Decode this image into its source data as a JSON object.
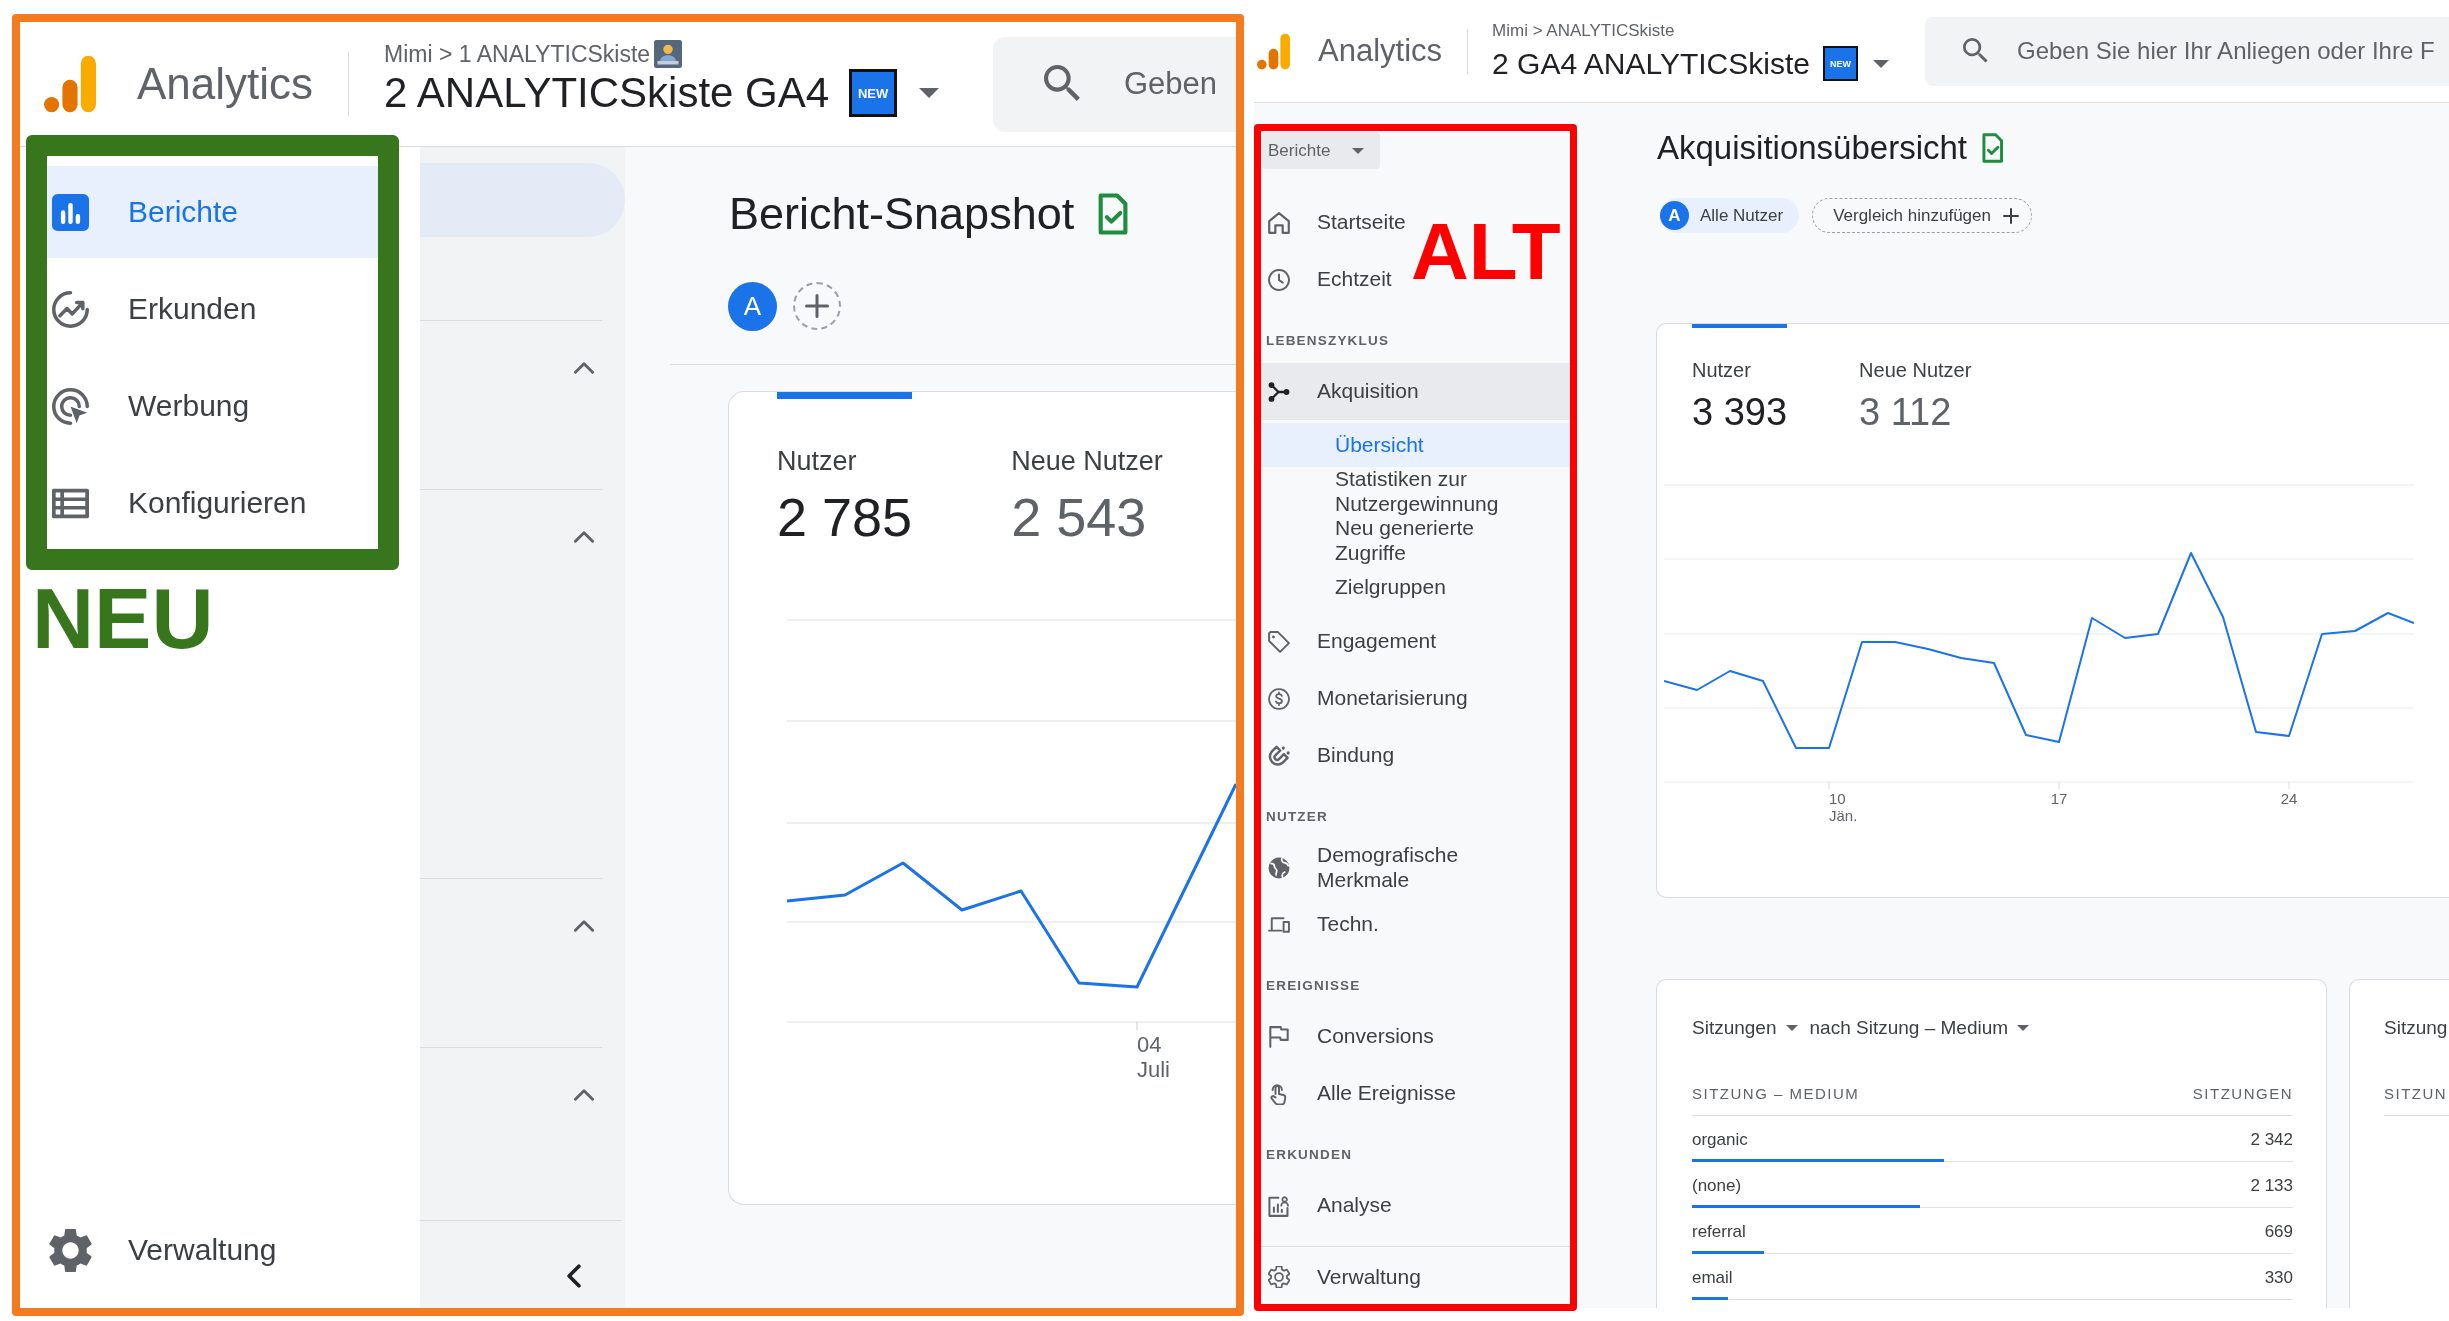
{
  "new_ui": {
    "header": {
      "product": "Analytics",
      "breadcrumb": "Mimi > 1 ANALYTICSkiste",
      "property": "2 ANALYTICSkiste GA4",
      "badge": "NEW",
      "search": {
        "placeholder": "Geben"
      }
    },
    "nav": [
      {
        "label": "Berichte",
        "selected": true
      },
      {
        "label": "Erkunden",
        "selected": false
      },
      {
        "label": "Werbung",
        "selected": false
      },
      {
        "label": "Konfigurieren",
        "selected": false
      }
    ],
    "admin": "Verwaltung",
    "annotation": "NEU",
    "report_groups": [
      {
        "expanded": true
      },
      {
        "expanded": true
      },
      {
        "expanded": true
      },
      {
        "expanded": true
      }
    ],
    "page_title": "Bericht-Snapshot",
    "segment_avatar": "A",
    "metrics": [
      {
        "label": "Nutzer",
        "value": "2 785",
        "selected": true
      },
      {
        "label": "Neue Nutzer",
        "value": "2 543",
        "selected": false
      }
    ],
    "x_axis_labels": [
      {
        "day": "04",
        "month": "Juli"
      }
    ]
  },
  "old_ui": {
    "header": {
      "product": "Analytics",
      "breadcrumb": "Mimi > ANALYTICSkiste",
      "property": "2 GA4 ANALYTICSkiste",
      "badge": "NEW",
      "search": {
        "placeholder": "Geben Sie hier Ihr Anliegen oder Ihre F"
      }
    },
    "report_menu": "Berichte",
    "nav": [
      {
        "kind": "item",
        "label": "Startseite",
        "selected": false
      },
      {
        "kind": "item",
        "label": "Echtzeit",
        "selected": false
      },
      {
        "kind": "heading",
        "label": "LEBENSZYKLUS"
      },
      {
        "kind": "item",
        "label": "Akquisition",
        "selected": true,
        "children": [
          {
            "label": "Übersicht",
            "selected": true
          },
          {
            "label": "Statistiken zur Nutzergewinnung",
            "selected": false
          },
          {
            "label": "Neu generierte Zugriffe",
            "selected": false
          },
          {
            "label": "Zielgruppen",
            "selected": false
          }
        ]
      },
      {
        "kind": "item",
        "label": "Engagement",
        "selected": false
      },
      {
        "kind": "item",
        "label": "Monetarisierung",
        "selected": false
      },
      {
        "kind": "item",
        "label": "Bindung",
        "selected": false
      },
      {
        "kind": "heading",
        "label": "NUTZER"
      },
      {
        "kind": "item",
        "label": "Demografische Merkmale",
        "selected": false
      },
      {
        "kind": "item",
        "label": "Techn.",
        "selected": false
      },
      {
        "kind": "heading",
        "label": "EREIGNISSE"
      },
      {
        "kind": "item",
        "label": "Conversions",
        "selected": false
      },
      {
        "kind": "item",
        "label": "Alle Ereignisse",
        "selected": false
      },
      {
        "kind": "heading",
        "label": "ERKUNDEN"
      },
      {
        "kind": "item",
        "label": "Analyse",
        "selected": false
      }
    ],
    "admin": "Verwaltung",
    "annotation": "ALT",
    "page_title": "Akquisitionsübersicht",
    "segment": {
      "avatar": "A",
      "label": "Alle Nutzer"
    },
    "add_comparison": "Vergleich hinzufügen",
    "metrics": [
      {
        "label": "Nutzer",
        "value": "3 393",
        "selected": true
      },
      {
        "label": "Neue Nutzer",
        "value": "3 112",
        "selected": false
      }
    ],
    "x_axis_labels": [
      {
        "day": "10",
        "month": "Jän."
      },
      {
        "day": "17"
      },
      {
        "day": "24"
      }
    ],
    "sessions_card": {
      "metric_menu": "Sitzungen",
      "dimension_menu": "nach Sitzung – Medium",
      "columns": [
        "SITZUNG – MEDIUM",
        "SITZUNGEN"
      ],
      "rows": [
        {
          "label": "organic",
          "value": "2 342",
          "level": 0.42
        },
        {
          "label": "(none)",
          "value": "2 133",
          "level": 0.38
        },
        {
          "label": "referral",
          "value": "669",
          "level": 0.12
        },
        {
          "label": "email",
          "value": "330",
          "level": 0.06
        }
      ]
    },
    "next_card": {
      "metric_menu": "Sitzung",
      "column": "SITZUN"
    }
  }
}
